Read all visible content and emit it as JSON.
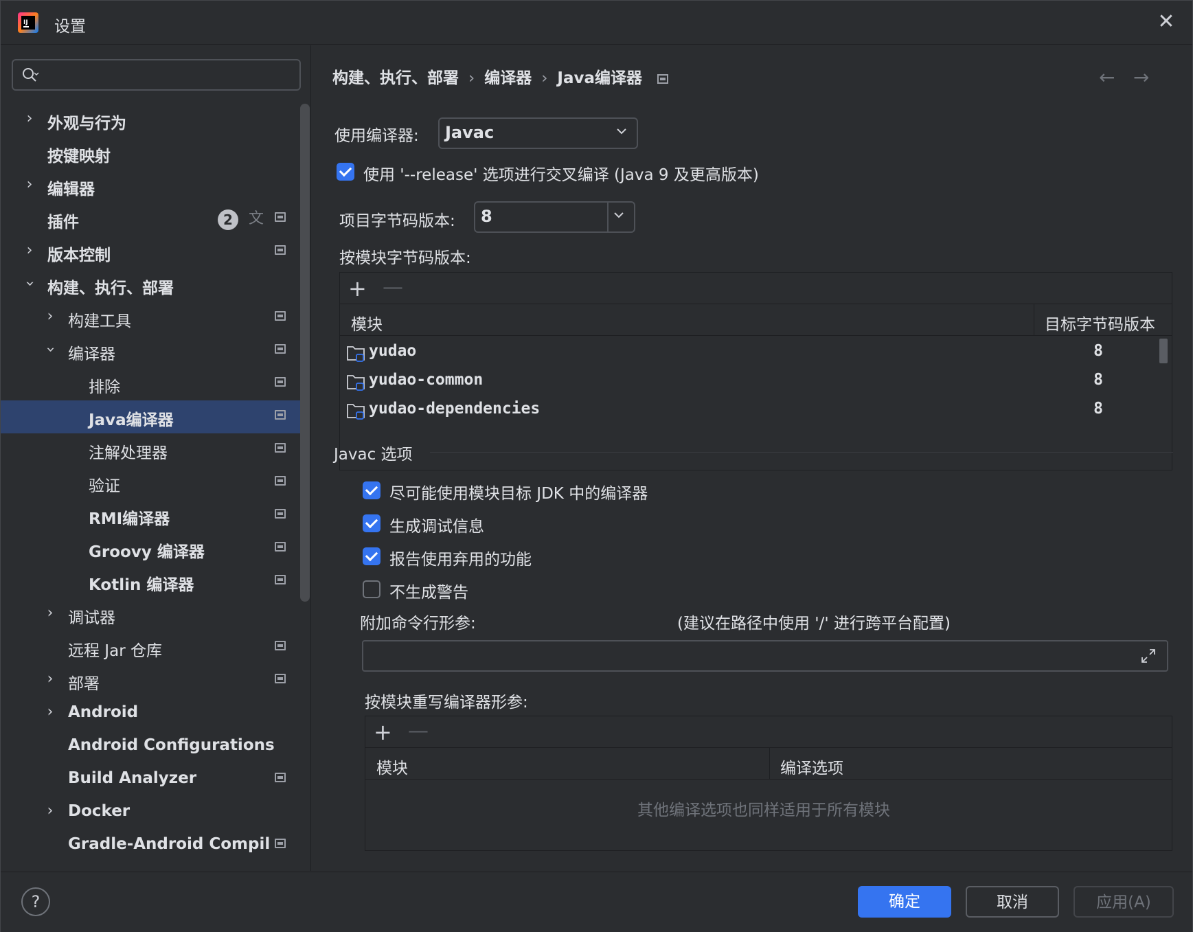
{
  "window": {
    "title": "设置",
    "close_icon": "close-icon"
  },
  "sidebar": {
    "search_placeholder": "",
    "plugins_badge": "2",
    "items": [
      {
        "label": "外观与行为"
      },
      {
        "label": "按键映射"
      },
      {
        "label": "编辑器"
      },
      {
        "label": "插件"
      },
      {
        "label": "版本控制"
      },
      {
        "label": "构建、执行、部署"
      },
      {
        "label": "构建工具"
      },
      {
        "label": "编译器"
      },
      {
        "label": "排除"
      },
      {
        "label": "Java编译器"
      },
      {
        "label": "注解处理器"
      },
      {
        "label": "验证"
      },
      {
        "label": "RMI编译器"
      },
      {
        "label": "Groovy 编译器"
      },
      {
        "label": "Kotlin 编译器"
      },
      {
        "label": "调试器"
      },
      {
        "label": "远程 Jar 仓库"
      },
      {
        "label": "部署"
      },
      {
        "label": "Android"
      },
      {
        "label": "Android Configurations"
      },
      {
        "label": "Build Analyzer"
      },
      {
        "label": "Docker"
      },
      {
        "label": "Gradle-Android Compil"
      }
    ]
  },
  "breadcrumb": [
    "构建、执行、部署",
    "编译器",
    "Java编译器"
  ],
  "compiler": {
    "use_compiler_label": "使用编译器:",
    "use_compiler_value": "Javac",
    "release_option_label": "使用 '--release' 选项进行交叉编译 (Java 9 及更高版本)",
    "release_option_checked": true,
    "bytecode_label": "项目字节码版本:",
    "bytecode_value": "8",
    "per_module_label": "按模块字节码版本:",
    "module_table": {
      "headers": [
        "模块",
        "目标字节码版本"
      ],
      "rows": [
        {
          "module": "yudao",
          "version": "8"
        },
        {
          "module": "yudao-common",
          "version": "8"
        },
        {
          "module": "yudao-dependencies",
          "version": "8"
        }
      ]
    }
  },
  "javac": {
    "section_title": "Javac 选项",
    "options": [
      {
        "label": "尽可能使用模块目标 JDK 中的编译器",
        "checked": true
      },
      {
        "label": "生成调试信息",
        "checked": true
      },
      {
        "label": "报告使用弃用的功能",
        "checked": true
      },
      {
        "label": "不生成警告",
        "checked": false
      }
    ],
    "cmdline_label": "附加命令行形参:",
    "cmdline_hint": "(建议在路径中使用 '/' 进行跨平台配置)",
    "cmdline_value": "",
    "override_label": "按模块重写编译器形参:",
    "override_table": {
      "headers": [
        "模块",
        "编译选项"
      ],
      "empty_text": "其他编译选项也同样适用于所有模块"
    }
  },
  "footer": {
    "help": "?",
    "ok": "确定",
    "cancel": "取消",
    "apply": "应用(A)"
  }
}
